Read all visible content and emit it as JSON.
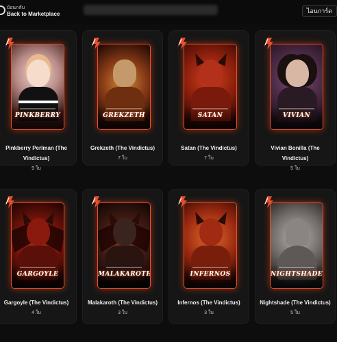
{
  "header": {
    "back_small": "ย้อนกลับ",
    "back_label": "Back to Marketplace",
    "my_cards_label": "ไอนการ์ด"
  },
  "colors": {
    "accent": "#e8502d",
    "background": "#0d0d0d",
    "tile": "#161616"
  },
  "cards": [
    {
      "name": "PINKBERRY",
      "title": "Pinkberry Perlman (The Vindictus)",
      "price": "9 ใบ"
    },
    {
      "name": "GREKZETH",
      "title": "Grekzeth (The Vindictus)",
      "price": "7 ใบ"
    },
    {
      "name": "SATAN",
      "title": "Satan (The Vindictus)",
      "price": "7 ใบ"
    },
    {
      "name": "VIVIAN",
      "title": "Vivian Bonilla (The Vindictus)",
      "price": "5 ใบ"
    },
    {
      "name": "GARGOYLE",
      "title": "Gargoyle (The Vindictus)",
      "price": "4 ใบ"
    },
    {
      "name": "MALAKAROTH",
      "title": "Malakaroth (The Vindictus)",
      "price": "3 ใบ"
    },
    {
      "name": "INFERNOS",
      "title": "Infernos (The Vindictus)",
      "price": "3 ใบ"
    },
    {
      "name": "NIGHTSHADE",
      "title": "Nightshade (The Vindictus)",
      "price": "5 ใบ"
    }
  ]
}
